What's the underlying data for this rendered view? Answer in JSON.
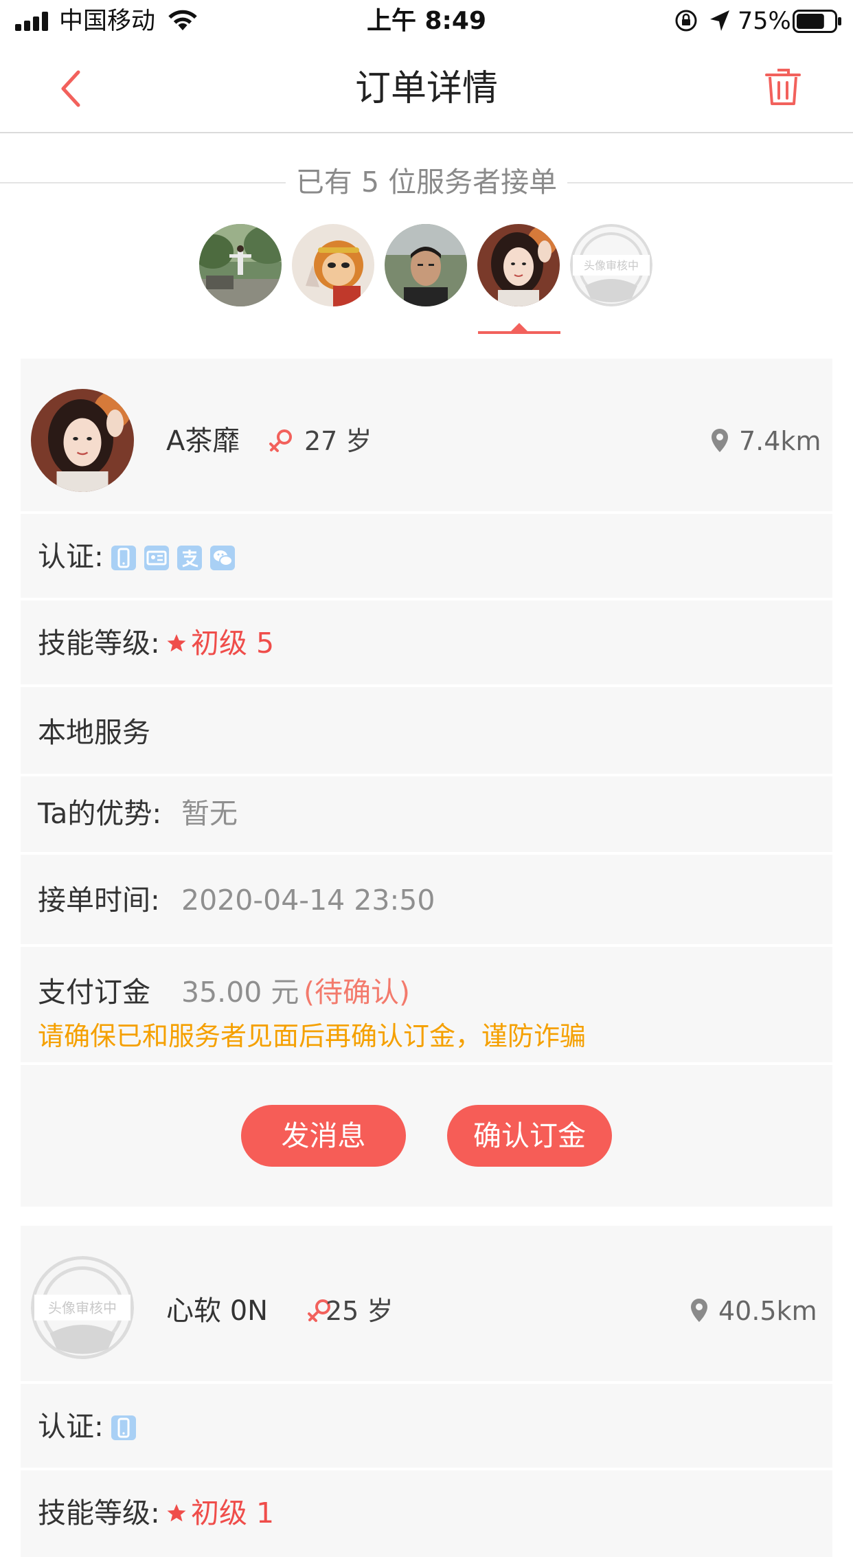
{
  "status_bar": {
    "carrier": "中国移动",
    "time": "上午 8:49",
    "battery_percent": "75%",
    "battery_level": 0.75
  },
  "nav": {
    "title": "订单详情",
    "back_icon": "chevron-left-icon",
    "delete_icon": "trash-icon"
  },
  "accepted": {
    "title": "已有 5 位服务者接单",
    "selected_index": 3,
    "avatars": [
      {
        "kind": "photo-outdoor"
      },
      {
        "kind": "photo-monkey-king"
      },
      {
        "kind": "photo-man"
      },
      {
        "kind": "photo-woman"
      },
      {
        "kind": "pending",
        "label": "头像审核中"
      }
    ]
  },
  "providers": [
    {
      "name": "A茶靡",
      "age": "27 岁",
      "distance": "7.4km",
      "avatar": {
        "kind": "photo-woman"
      },
      "verify_label": "认证:",
      "verify_icons": [
        "phone-icon",
        "id-card-icon",
        "alipay-icon",
        "wechat-icon"
      ],
      "skill_label": "技能等级:",
      "skill_value": "初级 5",
      "service_type": "本地服务",
      "advantage_label": "Ta的优势:",
      "advantage_value": "暂无",
      "accept_time_label": "接单时间:",
      "accept_time_value": "2020-04-14 23:50",
      "deposit_label": "支付订金",
      "deposit_value": "35.00 元",
      "deposit_status": "(待确认)",
      "warning": "请确保已和服务者见面后再确认订金，谨防诈骗",
      "message_button": "发消息",
      "confirm_button": "确认订金"
    },
    {
      "name": "心软 0N",
      "age": "25 岁",
      "distance": "40.5km",
      "avatar": {
        "kind": "pending",
        "label": "头像审核中"
      },
      "verify_label": "认证:",
      "verify_icons": [
        "phone-icon"
      ],
      "skill_label": "技能等级:",
      "skill_value": "初级 1"
    }
  ],
  "colors": {
    "accent_red": "#f65d57",
    "warning_orange": "#f5a000",
    "verify_blue": "#a9d0f5",
    "card_bg": "#f7f7f7"
  }
}
